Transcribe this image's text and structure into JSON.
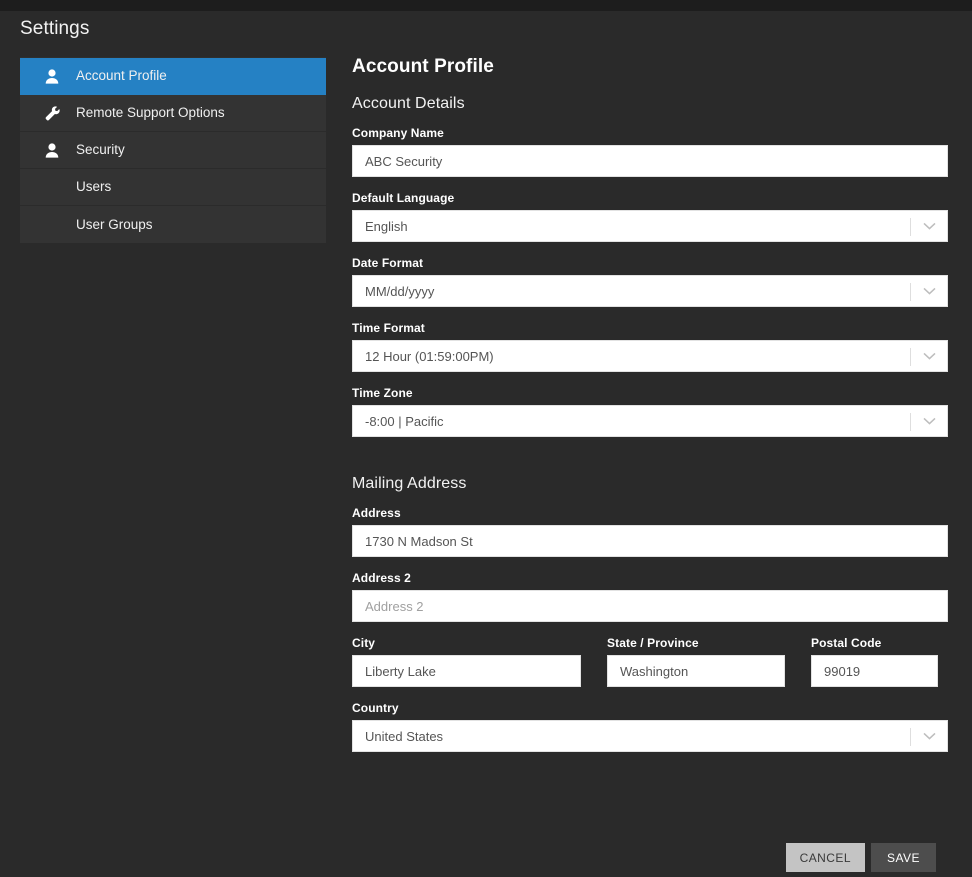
{
  "window": {
    "title": "Settings",
    "accent_color": "#2581c4",
    "background_color": "#2a2a2a",
    "sidebar_item_color": "#333333"
  },
  "sidebar": {
    "title": "Settings",
    "items": [
      {
        "label": "Account Profile",
        "icon": "user-icon",
        "active": true,
        "sub": false
      },
      {
        "label": "Remote Support Options",
        "icon": "wrench-icon",
        "active": false,
        "sub": false
      },
      {
        "label": "Security",
        "icon": "user-icon",
        "active": false,
        "sub": false
      },
      {
        "label": "Users",
        "icon": "",
        "active": false,
        "sub": true
      },
      {
        "label": "User Groups",
        "icon": "",
        "active": false,
        "sub": true
      }
    ]
  },
  "main": {
    "page_title": "Account Profile",
    "sections": {
      "account_details": {
        "title": "Account Details",
        "fields": {
          "company_name": {
            "label": "Company Name",
            "value": "ABC Security",
            "placeholder": "Company Name"
          },
          "default_language": {
            "label": "Default Language",
            "value": "English"
          },
          "date_format": {
            "label": "Date Format",
            "value": "MM/dd/yyyy"
          },
          "time_format": {
            "label": "Time Format",
            "value": "12 Hour (01:59:00PM)"
          },
          "time_zone": {
            "label": "Time Zone",
            "value": "-8:00 | Pacific"
          }
        }
      },
      "mailing_address": {
        "title": "Mailing Address",
        "fields": {
          "address": {
            "label": "Address",
            "value": "1730 N Madson St",
            "placeholder": "Address"
          },
          "address2": {
            "label": "Address 2",
            "value": "",
            "placeholder": "Address 2"
          },
          "city": {
            "label": "City",
            "value": "Liberty Lake",
            "placeholder": "City"
          },
          "state": {
            "label": "State / Province",
            "value": "Washington",
            "placeholder": "State / Province"
          },
          "postal_code": {
            "label": "Postal Code",
            "value": "99019",
            "placeholder": "Postal Code"
          },
          "country": {
            "label": "Country",
            "value": "United States"
          }
        }
      }
    }
  },
  "footer": {
    "cancel_label": "CANCEL",
    "save_label": "SAVE"
  }
}
